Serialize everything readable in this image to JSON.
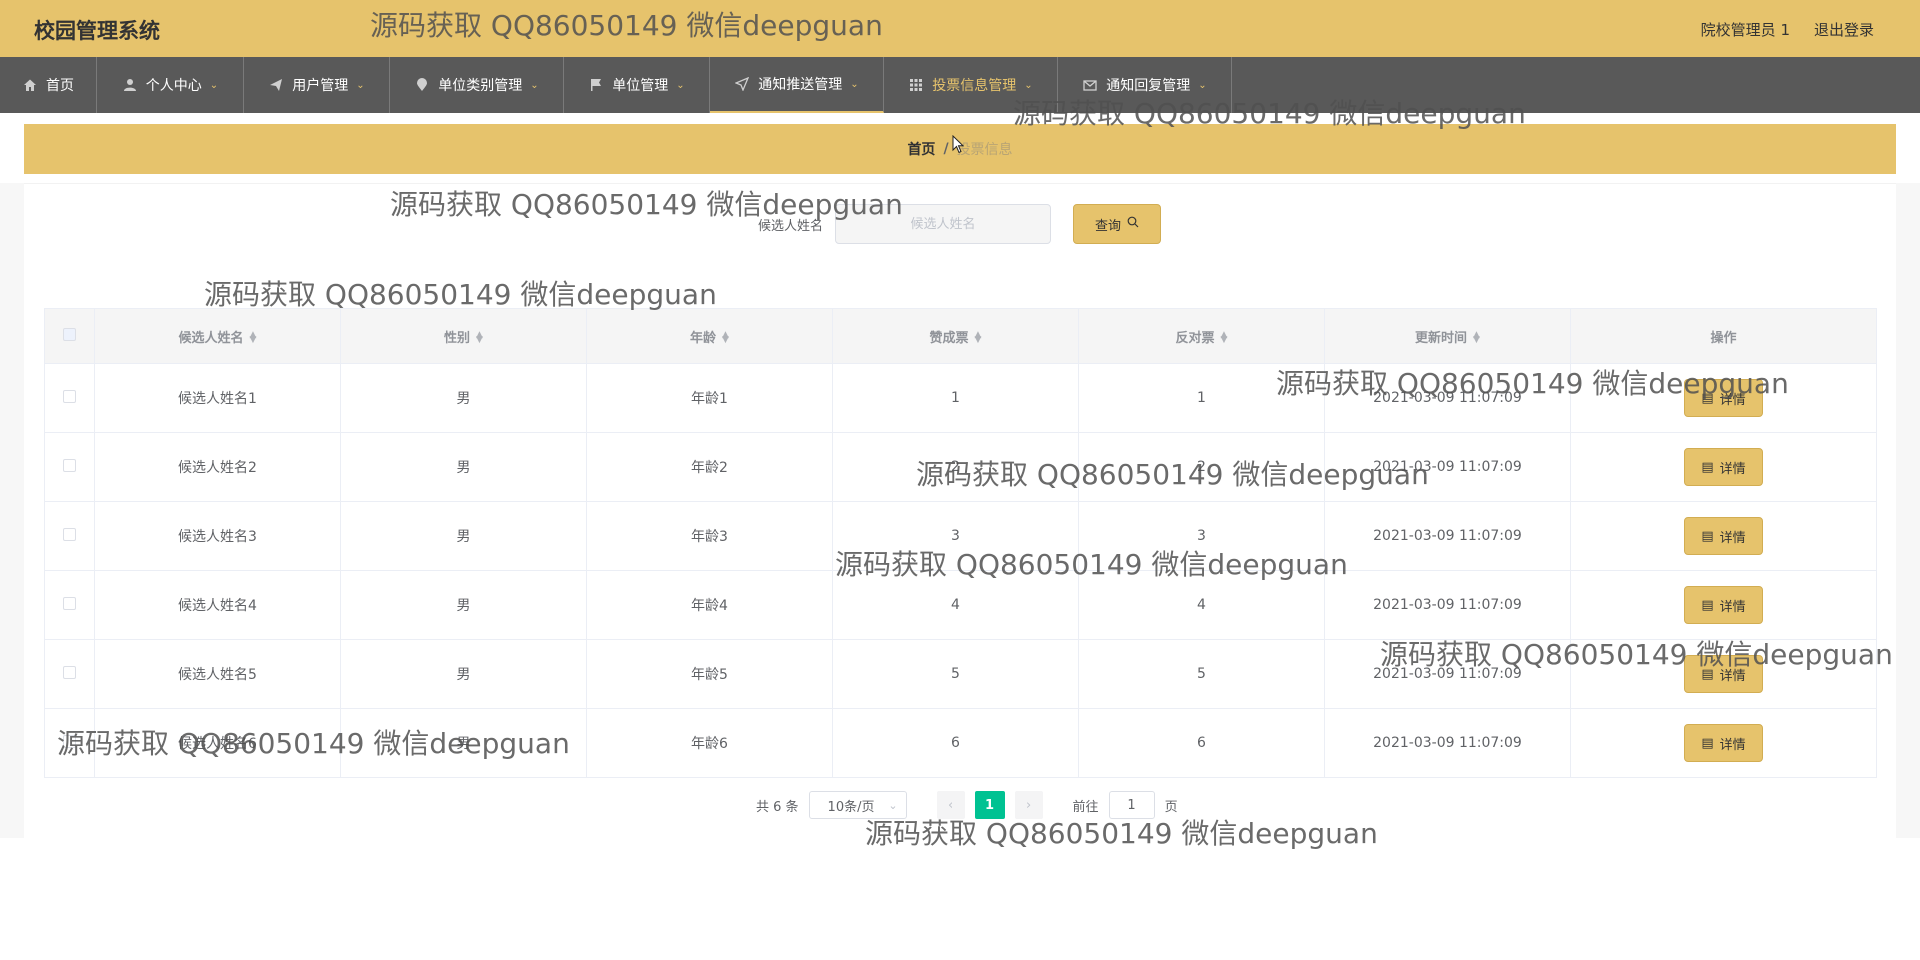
{
  "header": {
    "title": "校园管理系统",
    "user": "院校管理员 1",
    "logout": "退出登录"
  },
  "nav": [
    {
      "label": "首页",
      "icon": "home-icon"
    },
    {
      "label": "个人中心",
      "icon": "user-icon"
    },
    {
      "label": "用户管理",
      "icon": "send-icon"
    },
    {
      "label": "单位类别管理",
      "icon": "location-icon"
    },
    {
      "label": "单位管理",
      "icon": "flag-icon"
    },
    {
      "label": "通知推送管理",
      "icon": "navigation-icon"
    },
    {
      "label": "投票信息管理",
      "icon": "grid-icon"
    },
    {
      "label": "通知回复管理",
      "icon": "mail-icon"
    }
  ],
  "breadcrumb": {
    "home": "首页",
    "sep": "/",
    "current": "投票信息"
  },
  "search": {
    "label": "候选人姓名",
    "placeholder": "候选人姓名",
    "button": "查询"
  },
  "table": {
    "headers": [
      "候选人姓名",
      "性别",
      "年龄",
      "赞成票",
      "反对票",
      "更新时间",
      "操作"
    ],
    "action_label": "详情",
    "rows": [
      {
        "name": "候选人姓名1",
        "gender": "男",
        "age": "年龄1",
        "yes": "1",
        "no": "1",
        "time": "2021-03-09 11:07:09"
      },
      {
        "name": "候选人姓名2",
        "gender": "男",
        "age": "年龄2",
        "yes": "2",
        "no": "2",
        "time": "2021-03-09 11:07:09"
      },
      {
        "name": "候选人姓名3",
        "gender": "男",
        "age": "年龄3",
        "yes": "3",
        "no": "3",
        "time": "2021-03-09 11:07:09"
      },
      {
        "name": "候选人姓名4",
        "gender": "男",
        "age": "年龄4",
        "yes": "4",
        "no": "4",
        "time": "2021-03-09 11:07:09"
      },
      {
        "name": "候选人姓名5",
        "gender": "男",
        "age": "年龄5",
        "yes": "5",
        "no": "5",
        "time": "2021-03-09 11:07:09"
      },
      {
        "name": "候选人姓名6",
        "gender": "男",
        "age": "年龄6",
        "yes": "6",
        "no": "6",
        "time": "2021-03-09 11:07:09"
      }
    ]
  },
  "pagination": {
    "total": "共 6 条",
    "page_size": "10条/页",
    "current": "1",
    "goto_prefix": "前往",
    "goto_value": "1",
    "goto_suffix": "页"
  },
  "watermark": "源码获取 QQ86050149 微信deepguan",
  "colors": {
    "accent": "#e6c36c",
    "nav_bg": "#595959",
    "page_active": "#00c292"
  }
}
